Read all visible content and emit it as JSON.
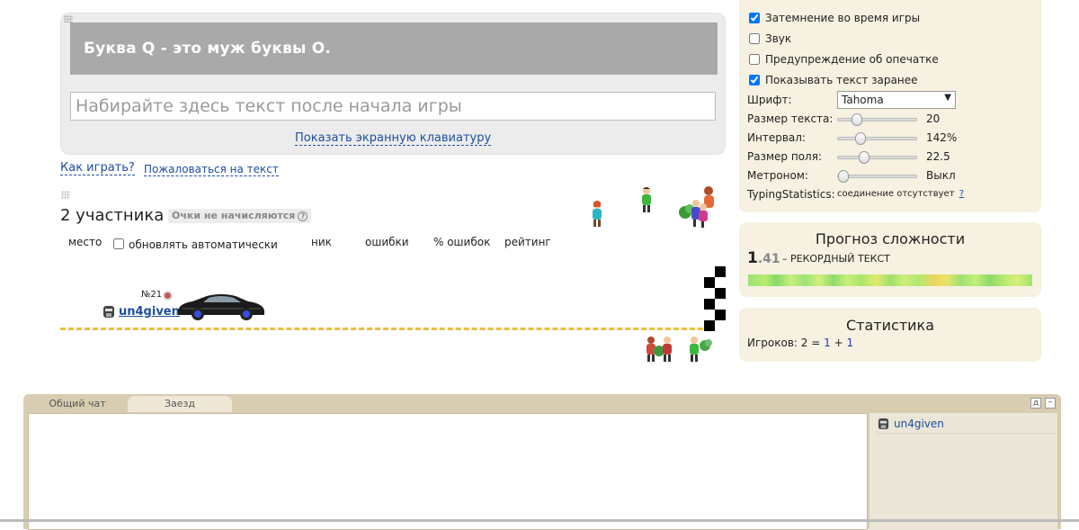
{
  "type_panel": {
    "text": "Буква Q - это муж буквы О.",
    "input_placeholder": "Набирайте здесь текст после начала игры",
    "keyboard_link": "Показать экранную клавиатуру"
  },
  "links": {
    "how_to_play": "Как играть?",
    "complain": "Пожаловаться на текст"
  },
  "participants": {
    "title": "2 участника",
    "points_badge": "Очки не начисляются",
    "columns": {
      "place": "место",
      "auto_update": "обновлять автоматически",
      "nick": "ник",
      "errors": "ошибки",
      "error_percent": "% ошибок",
      "rating": "рейтинг"
    },
    "auto_update_checked": false
  },
  "race": {
    "player_rank": "№21",
    "player_name": "un4given"
  },
  "settings": {
    "darken": {
      "label": "Затемнение во время игры",
      "checked": true
    },
    "sound": {
      "label": "Звук",
      "checked": false
    },
    "typo_warning": {
      "label": "Предупреждение об опечатке",
      "checked": false
    },
    "show_text": {
      "label": "Показывать текст заранее",
      "checked": true
    },
    "font_label": "Шрифт:",
    "font_value": "Tahoma",
    "text_size": {
      "label": "Размер текста:",
      "value": "20",
      "level": 0.2
    },
    "interval": {
      "label": "Интервал:",
      "value": "142%",
      "level": 0.25
    },
    "field_size": {
      "label": "Размер поля:",
      "value": "22.5",
      "level": 0.3
    },
    "metronome": {
      "label": "Метроном:",
      "value": "Выкл",
      "level": 0.0
    },
    "typing_stats": {
      "label": "TypingStatistics:",
      "status": "соединение отсутствует",
      "help": "?"
    }
  },
  "difficulty": {
    "title": "Прогноз сложности",
    "value_int": "1",
    "value_dec": ".41",
    "text": "– РЕКОРДНЫЙ ТЕКСТ"
  },
  "stats": {
    "title": "Статистика",
    "players_label": "Игроков:",
    "total": "2",
    "eq": "=",
    "a": "1",
    "plus": "+",
    "b": "1"
  },
  "chat": {
    "tab_general": "Общий чат",
    "tab_race": "Заезд",
    "pin": "д",
    "minimize": "–",
    "user": "un4given"
  }
}
